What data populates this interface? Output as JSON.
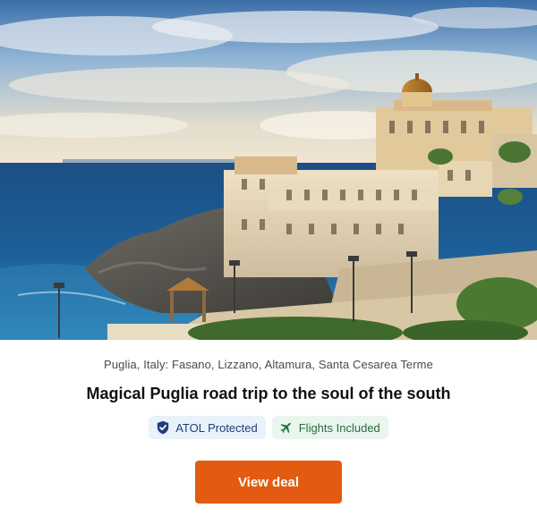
{
  "deal": {
    "location": "Puglia, Italy: Fasano, Lizzano, Altamura, Santa Cesarea Terme",
    "title": "Magical Puglia road trip to the soul of the south",
    "badges": [
      {
        "label": "ATOL Protected",
        "icon": "shield-check-icon",
        "color": "#1d3f7a"
      },
      {
        "label": "Flights Included",
        "icon": "plane-icon",
        "color": "#2a6a3f"
      }
    ],
    "cta_label": "View deal"
  },
  "colors": {
    "cta_background": "#e35b10",
    "cta_text": "#ffffff",
    "title": "#111111",
    "location": "#4a4a4a"
  }
}
